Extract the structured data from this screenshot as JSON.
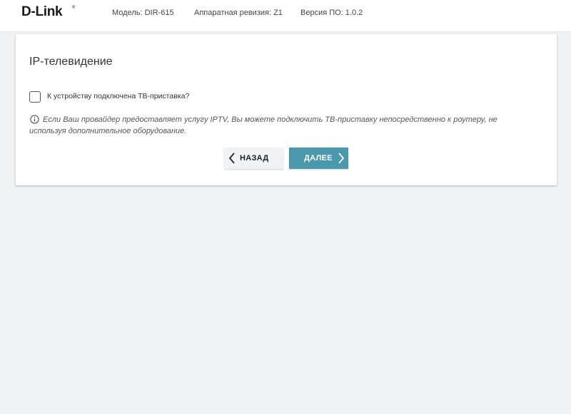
{
  "header": {
    "logo": "D-Link",
    "logo_mark": "®",
    "model": "Модель: DIR-615",
    "hw_revision": "Аппаратная ревизия: Z1",
    "fw_version": "Версия ПО: 1.0.2"
  },
  "main": {
    "title": "IP-телевидение",
    "checkbox_label": "К устройству подключена ТВ-приставка?",
    "checkbox_checked": false,
    "info_text": "Если Ваш провайдер предоставляет услугу IPTV, Вы можете подключить ТВ-приставку непосредственно к роутеру, не используя дополнительное оборудование.",
    "back_label": "НАЗАД",
    "next_label": "ДАЛЕЕ"
  },
  "icons": {
    "info": "info-icon",
    "back": "chevron-left-icon",
    "next": "chevron-right-icon"
  },
  "colors": {
    "background": "#f0f2f4",
    "card": "#ffffff",
    "next_button": "#4a98ab",
    "back_button": "#f1f2f3"
  }
}
